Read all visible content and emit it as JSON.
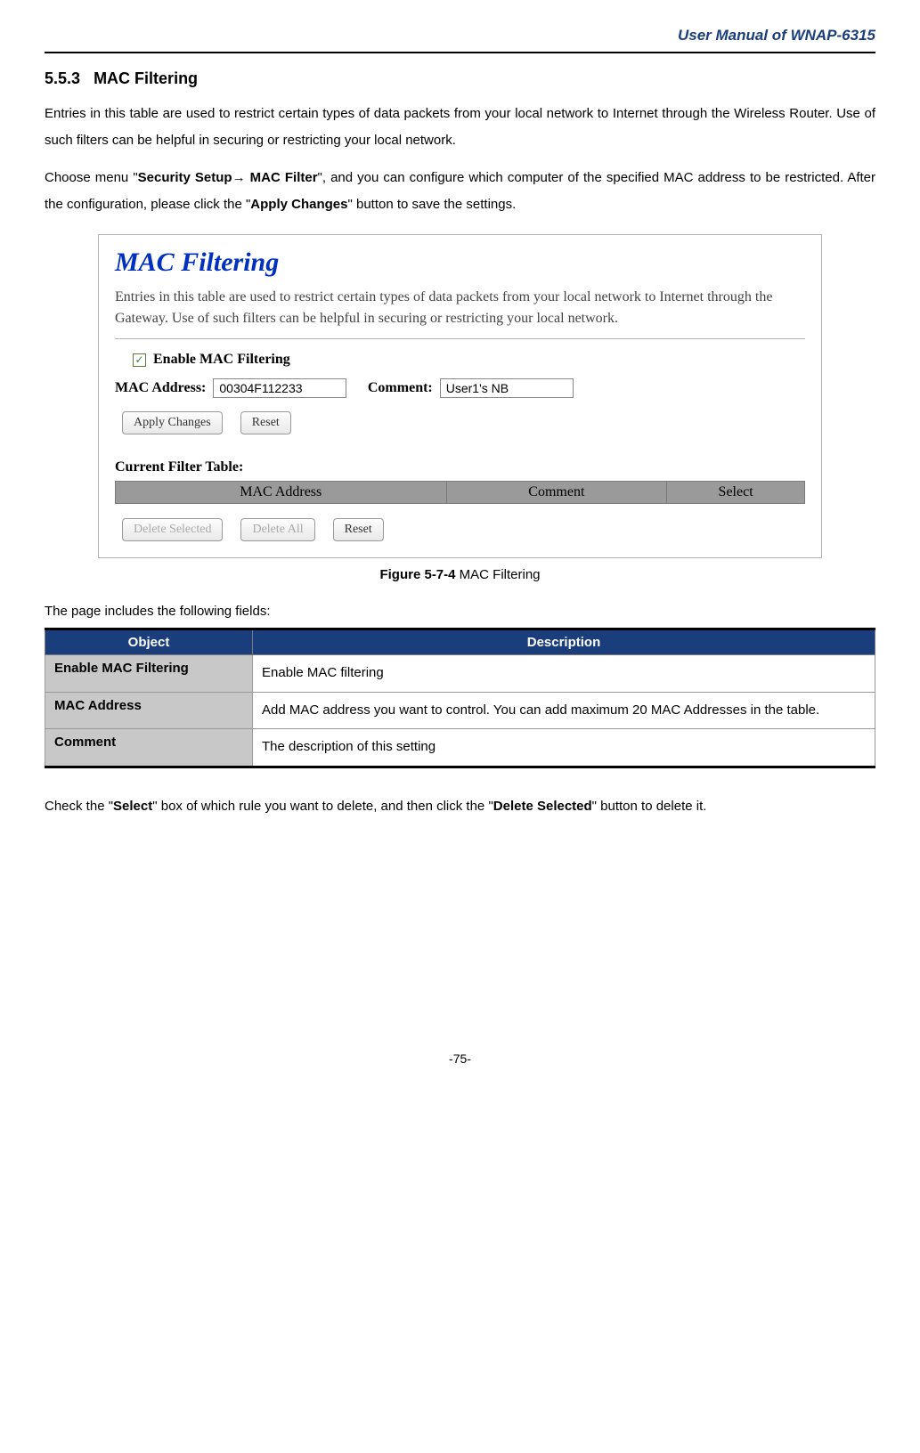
{
  "header": {
    "title": "User Manual of WNAP-6315"
  },
  "section": {
    "number": "5.5.3",
    "title": "MAC Filtering"
  },
  "paragraphs": {
    "p1": "Entries in this table are used to restrict certain types of data packets from your local network to Internet through the Wireless Router. Use of such filters can be helpful in securing or restricting your local network.",
    "p2_a": "Choose menu \"",
    "p2_bold1": "Security Setup",
    "p2_arrow": "→",
    "p2_bold2": " MAC Filter",
    "p2_b": "\", and you can configure which computer of the specified MAC address to be restricted. After the configuration, please click the \"",
    "p2_bold3": "Apply Changes",
    "p2_c": "\" button to save the settings."
  },
  "screenshot": {
    "title": "MAC Filtering",
    "desc": "Entries in this table are used to restrict certain types of data packets from your local network to Internet through the Gateway. Use of such filters can be helpful in securing or restricting your local network.",
    "enable_label": "Enable MAC Filtering",
    "mac_label": "MAC Address:",
    "mac_value": "00304F112233",
    "comment_label": "Comment:",
    "comment_value": "User1's NB",
    "apply_btn": "Apply Changes",
    "reset_btn": "Reset",
    "table_label": "Current Filter Table:",
    "table_headers": {
      "mac": "MAC Address",
      "comment": "Comment",
      "select": "Select"
    },
    "delete_selected_btn": "Delete Selected",
    "delete_all_btn": "Delete All",
    "reset2_btn": "Reset"
  },
  "figure": {
    "label": "Figure 5-7-4",
    "text": " MAC Filtering"
  },
  "fields_intro": "The page includes the following fields:",
  "fields_table": {
    "header_obj": "Object",
    "header_desc": "Description",
    "rows": [
      {
        "obj": "Enable MAC Filtering",
        "desc": "Enable MAC filtering"
      },
      {
        "obj": "MAC Address",
        "desc": "Add MAC address you want to control. You can add maximum 20 MAC Addresses in the table."
      },
      {
        "obj": "Comment",
        "desc": "The description of this setting"
      }
    ]
  },
  "footer_para": {
    "a": "Check the \"",
    "b1": "Select",
    "b": "\" box of which rule you want to delete, and then click the \"",
    "b2": "Delete Selected",
    "c": "\" button to delete it."
  },
  "page_number": "-75-"
}
